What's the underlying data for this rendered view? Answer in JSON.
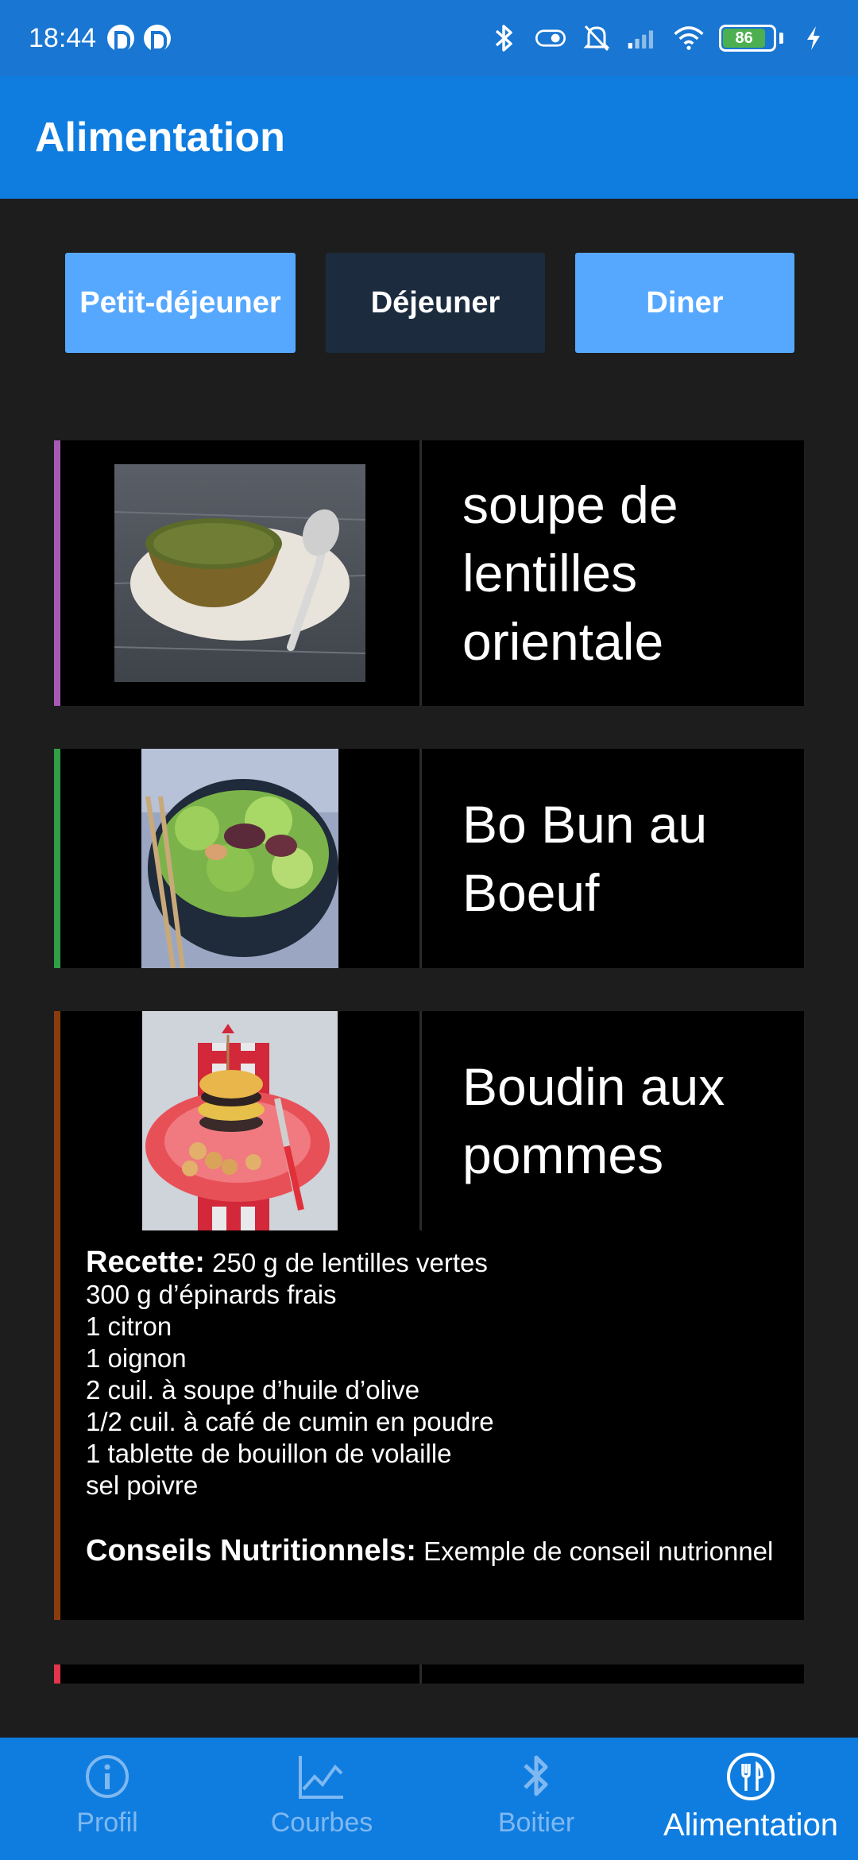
{
  "status": {
    "time": "18:44",
    "battery": "86"
  },
  "app_bar": {
    "title": "Alimentation"
  },
  "tabs": [
    {
      "label": "Petit-déjeuner",
      "state": "light"
    },
    {
      "label": "Déjeuner",
      "state": "selected"
    },
    {
      "label": "Diner",
      "state": "light"
    }
  ],
  "meals": [
    {
      "title_lines": [
        "soupe de",
        "lentilles",
        "orientale"
      ],
      "accent": "#a55bb5"
    },
    {
      "title_lines": [
        "Bo Bun au",
        "Boeuf"
      ],
      "accent": "#2f9e44"
    },
    {
      "title_lines": [
        "Boudin aux",
        "pommes"
      ],
      "accent": "#8a3c0c"
    },
    {
      "accent": "#e0354a"
    }
  ],
  "expanded": {
    "recipe_label": "Recette:",
    "recipe_lines": [
      "250 g de lentilles vertes",
      "300 g d’épinards frais",
      "1 citron",
      "1 oignon",
      "2 cuil. à soupe d’huile d’olive",
      "1/2 cuil. à café de cumin en poudre",
      "1 tablette de bouillon de volaille",
      "sel poivre"
    ],
    "advice_label": "Conseils Nutritionnels:",
    "advice_text": "Exemple de conseil nutrionnel"
  },
  "bottom_nav": [
    {
      "label": "Profil",
      "icon": "info-icon"
    },
    {
      "label": "Courbes",
      "icon": "chart-icon"
    },
    {
      "label": "Boitier",
      "icon": "bluetooth-icon"
    },
    {
      "label": "Alimentation",
      "icon": "cutlery-icon",
      "active": true
    }
  ]
}
